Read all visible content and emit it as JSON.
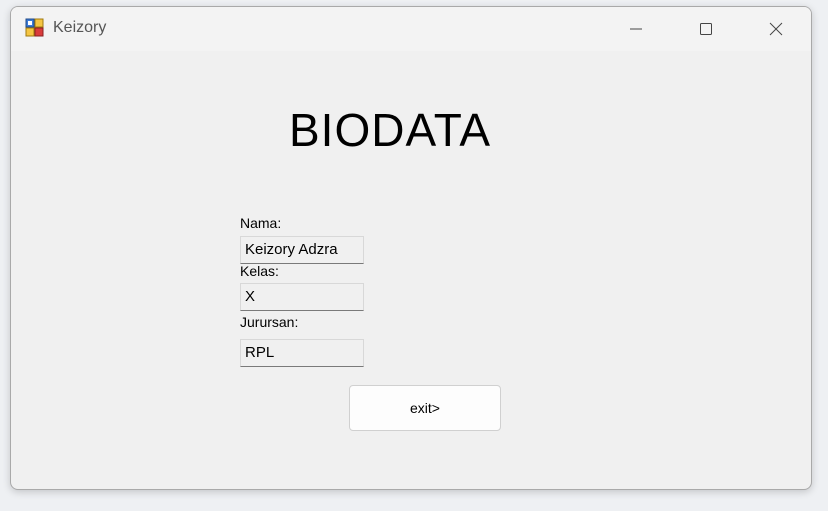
{
  "window": {
    "title": "Keizory",
    "icon": "windows-form-icon"
  },
  "form": {
    "heading": "BIODATA",
    "nama_label": "Nama:",
    "nama_value": "Keizory Adzra",
    "kelas_label": "Kelas:",
    "kelas_value": "X",
    "jurusan_label": "Jurursan:",
    "jurusan_value": "RPL",
    "exit_label": "exit>"
  },
  "colors": {
    "window_bg": "#f0f0f0",
    "titlebar_bg": "#f3f3f3",
    "field_border_bottom": "#7a7a7a"
  }
}
